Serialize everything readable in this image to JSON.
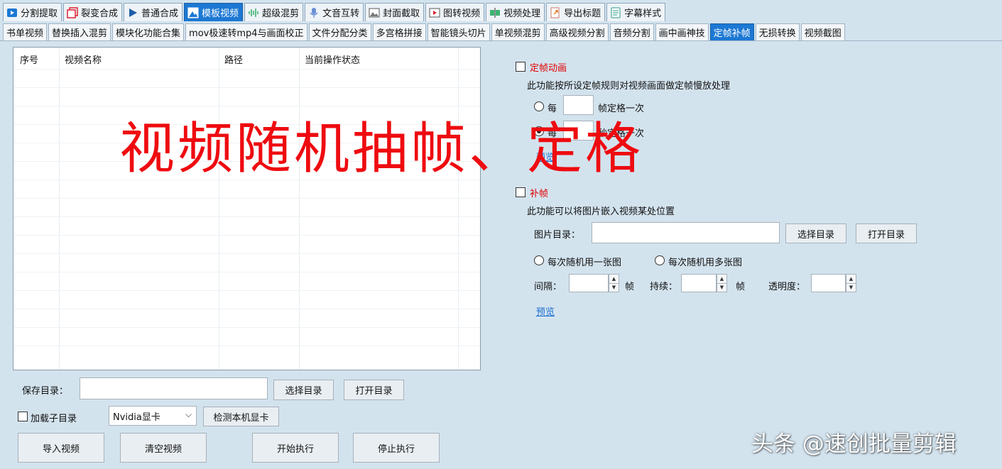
{
  "top_tabs": [
    {
      "label": "分割提取",
      "icon": "play-box-icon"
    },
    {
      "label": "裂变合成",
      "icon": "copy-icon"
    },
    {
      "label": "普通合成",
      "icon": "play-triangle-icon"
    },
    {
      "label": "模板视频",
      "icon": "template-image-icon",
      "active": true
    },
    {
      "label": "超级混剪",
      "icon": "waveform-icon"
    },
    {
      "label": "文音互转",
      "icon": "microphone-icon"
    },
    {
      "label": "封面截取",
      "icon": "picture-icon"
    },
    {
      "label": "图转视频",
      "icon": "photo-video-icon"
    },
    {
      "label": "视频处理",
      "icon": "video-split-icon"
    },
    {
      "label": "导出标题",
      "icon": "export-doc-icon"
    },
    {
      "label": "字幕样式",
      "icon": "subtitle-doc-icon"
    }
  ],
  "sub_tabs": [
    {
      "label": "书单视频"
    },
    {
      "label": "替换插入混剪"
    },
    {
      "label": "模块化功能合集"
    },
    {
      "label": "mov极速转mp4与画面校正"
    },
    {
      "label": "文件分配分类"
    },
    {
      "label": "多宫格拼接"
    },
    {
      "label": "智能镜头切片"
    },
    {
      "label": "单视频混剪"
    },
    {
      "label": "高级视频分割"
    },
    {
      "label": "音频分割"
    },
    {
      "label": "画中画神技"
    },
    {
      "label": "定帧补帧",
      "active": true
    },
    {
      "label": "无损转换"
    },
    {
      "label": "视频截图"
    }
  ],
  "table": {
    "columns": [
      "序号",
      "视频名称",
      "路径",
      "当前操作状态"
    ],
    "rows": []
  },
  "freeze": {
    "checkbox_label": "定帧动画",
    "description": "此功能按所设定帧规则对视频画面做定帧慢放处理",
    "option1_prefix": "每",
    "option1_suffix": "帧定格一次",
    "option2_prefix": "每",
    "option2_suffix": "秒定格一次",
    "preview": "预览"
  },
  "fill": {
    "checkbox_label": "补帧",
    "description": "此功能可以将图片嵌入视频某处位置",
    "image_dir_label": "图片目录：",
    "choose_dir": "选择目录",
    "open_dir": "打开目录",
    "random_one": "每次随机用一张图",
    "random_many": "每次随机用多张图",
    "interval_label": "间隔：",
    "interval_unit": "帧",
    "duration_label": "持续：",
    "duration_unit": "帧",
    "opacity_label": "透明度：",
    "preview": "预览"
  },
  "bottom": {
    "save_dir_label": "保存目录：",
    "choose_dir": "选择目录",
    "open_dir": "打开目录",
    "load_subdirs": "加载子目录",
    "gpu_selected": "Nvidia显卡",
    "detect_gpu": "检测本机显卡",
    "import_video": "导入视频",
    "clear_video": "清空视频",
    "start": "开始执行",
    "stop": "停止执行"
  },
  "overlay_caption": "视频随机抽帧、定格",
  "watermark": "头条 @速创批量剪辑",
  "colors": {
    "active_tab": "#1c78d3",
    "background": "#d3e3ee",
    "caption_red": "#ee0b10",
    "label_red": "#e00000",
    "link_blue": "#1a6fd0"
  }
}
